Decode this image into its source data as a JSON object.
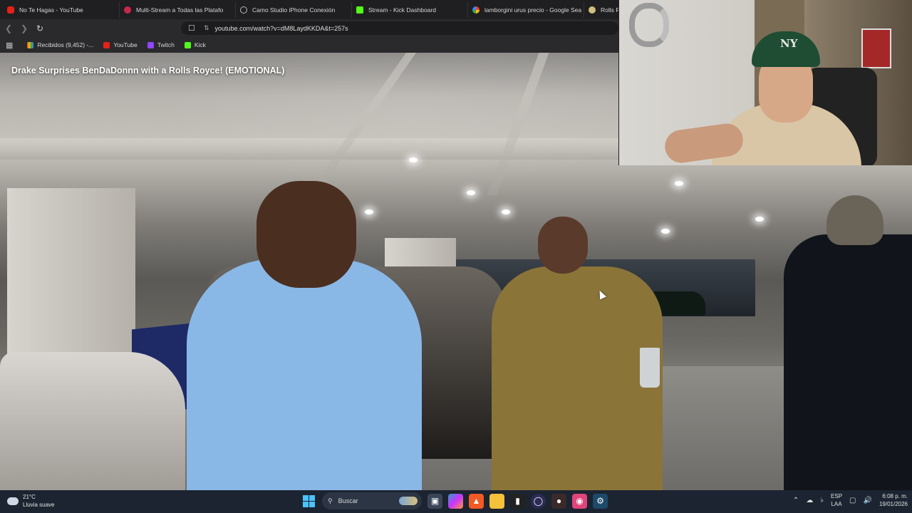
{
  "browser": {
    "tabs": [
      {
        "label": "No Te Hagas - YouTube",
        "icon": "youtube-icon"
      },
      {
        "label": "Multi-Stream a Todas las Platafo",
        "icon": "multistream-icon"
      },
      {
        "label": "Camo Studio iPhone Conexión",
        "icon": "camo-icon"
      },
      {
        "label": "Stream - Kick Dashboard",
        "icon": "kick-icon"
      },
      {
        "label": "lamborgini urus precio - Google Sea",
        "icon": "google-icon"
      },
      {
        "label": "Rolls Roy",
        "icon": "rolls-icon"
      }
    ],
    "url": "youtube.com/watch?v=dM8LaydKKDA&t=257s",
    "bookmarks": [
      {
        "label": "Recibidos (9,452) -...",
        "icon": "gmail-icon"
      },
      {
        "label": "YouTube",
        "icon": "youtube-icon"
      },
      {
        "label": "Twitch",
        "icon": "twitch-icon"
      },
      {
        "label": "Kick",
        "icon": "kick-icon"
      }
    ]
  },
  "video": {
    "title": "Drake Surprises BenDaDonnn with a Rolls Royce! (EMOTIONAL)"
  },
  "taskbar": {
    "weather_temp": "21°C",
    "weather_desc": "Lluvia suave",
    "search_label": "Buscar",
    "lang_top": "ESP",
    "lang_bottom": "LAA",
    "time": "6:08 p. m.",
    "date": "19/01/2026"
  },
  "colors": {
    "accent_windows": "#4cc2ff",
    "kick_green": "#53fc18",
    "youtube_red": "#e62117",
    "twitch_purple": "#9146ff"
  }
}
